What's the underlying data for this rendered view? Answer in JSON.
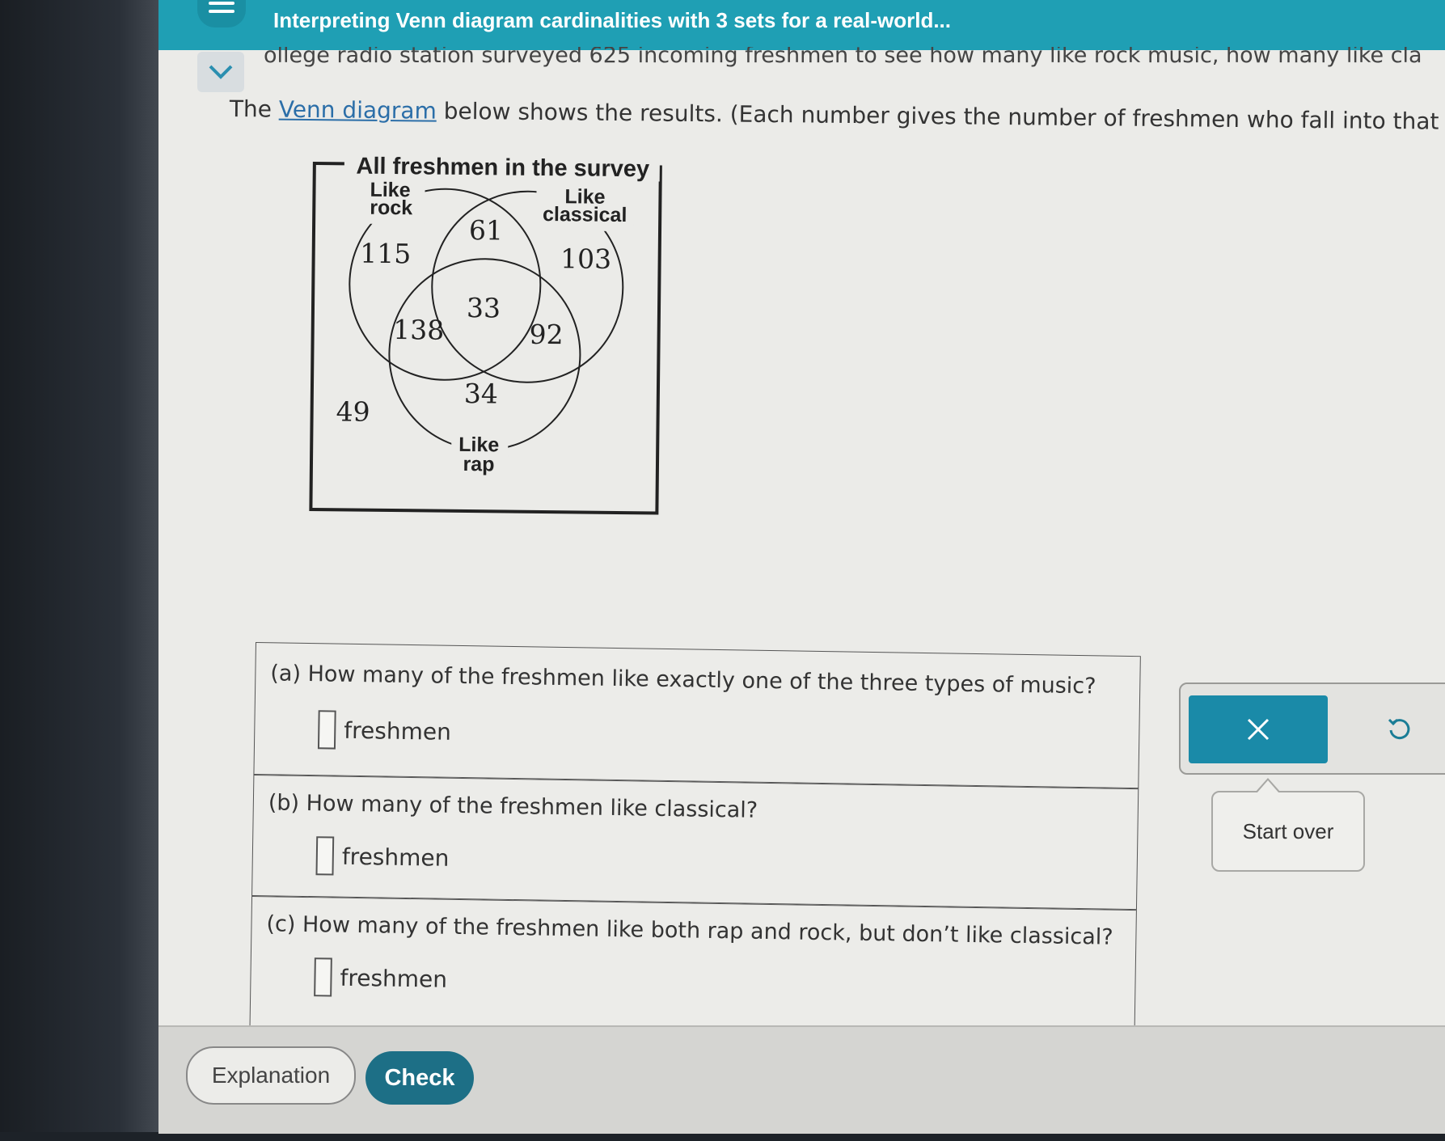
{
  "header": {
    "title": "Interpreting Venn diagram cardinalities with 3 sets for a real-world..."
  },
  "problem": {
    "cut_line": "ollege radio station surveyed 625 incoming freshmen to see how many like rock music, how many like cla",
    "intro_before": "The ",
    "intro_link": "Venn diagram",
    "intro_after": " below shows the results. (Each number gives the number of freshmen who fall into that Ve"
  },
  "venn": {
    "title": "All freshmen in the survey",
    "label_rock_1": "Like",
    "label_rock_2": "rock",
    "label_classical_1": "Like",
    "label_classical_2": "classical",
    "label_rap_1": "Like",
    "label_rap_2": "rap",
    "rock_only": "115",
    "rock_classical_only": "61",
    "classical_only": "103",
    "all_three": "33",
    "rock_rap_only": "138",
    "classical_rap_only": "92",
    "rap_only": "34",
    "none": "49"
  },
  "questions": [
    {
      "text": "(a) How many of the freshmen like exactly one of the three types of music?",
      "unit": "freshmen",
      "value": ""
    },
    {
      "text": "(b) How many of the freshmen like classical?",
      "unit": "freshmen",
      "value": ""
    },
    {
      "text": "(c) How many of the freshmen like both rap and rock, but don’t like classical?",
      "unit": "freshmen",
      "value": ""
    }
  ],
  "buttons": {
    "explanation": "Explanation",
    "check": "Check"
  },
  "tools": {
    "tooltip": "Start over"
  },
  "colors": {
    "topbar": "#1f9fb4",
    "check_button": "#1d6f86",
    "tool_active": "#1a8aa8",
    "link": "#2b6ea8"
  }
}
